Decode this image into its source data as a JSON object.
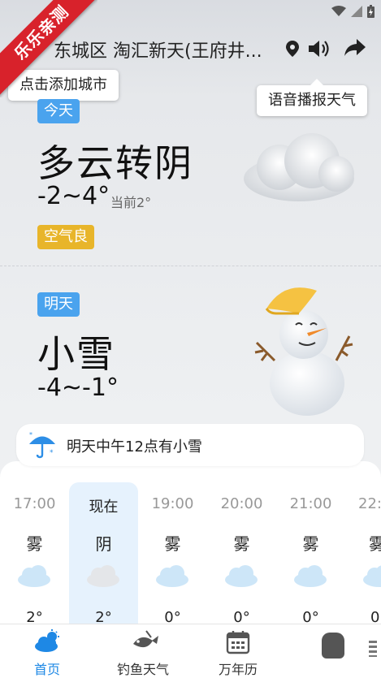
{
  "ribbon": {
    "text": "乐乐亲测"
  },
  "header": {
    "location": "东城区 淘汇新天(王府井...",
    "tooltip_left": "点击添加城市",
    "tooltip_right": "语音播报天气"
  },
  "today": {
    "tag": "今天",
    "condition": "多云转阴",
    "range": "-2~4°",
    "current": "当前2°",
    "aqi": "空气良"
  },
  "tomorrow": {
    "tag": "明天",
    "condition": "小雪",
    "range": "-4~-1°"
  },
  "alert": {
    "text": "明天中午12点有小雪",
    "icon": "umbrella-snow-icon"
  },
  "hourly": [
    {
      "time": "17:00",
      "cond": "雾",
      "temp": "2°"
    },
    {
      "time": "现在",
      "cond": "阴",
      "temp": "2°"
    },
    {
      "time": "19:00",
      "cond": "雾",
      "temp": "0°"
    },
    {
      "time": "20:00",
      "cond": "雾",
      "temp": "0°"
    },
    {
      "time": "21:00",
      "cond": "雾",
      "temp": "0°"
    },
    {
      "time": "22:",
      "cond": "雾",
      "temp": "0"
    }
  ],
  "nav": [
    {
      "label": "首页",
      "icon": "home-weather-icon"
    },
    {
      "label": "钓鱼天气",
      "icon": "fish-icon"
    },
    {
      "label": "万年历",
      "icon": "calendar-icon"
    }
  ],
  "colors": {
    "accent": "#1e88e5",
    "tag_blue": "#4aa3ee",
    "tag_yellow": "#e8b52a",
    "ribbon": "#d8222b"
  }
}
